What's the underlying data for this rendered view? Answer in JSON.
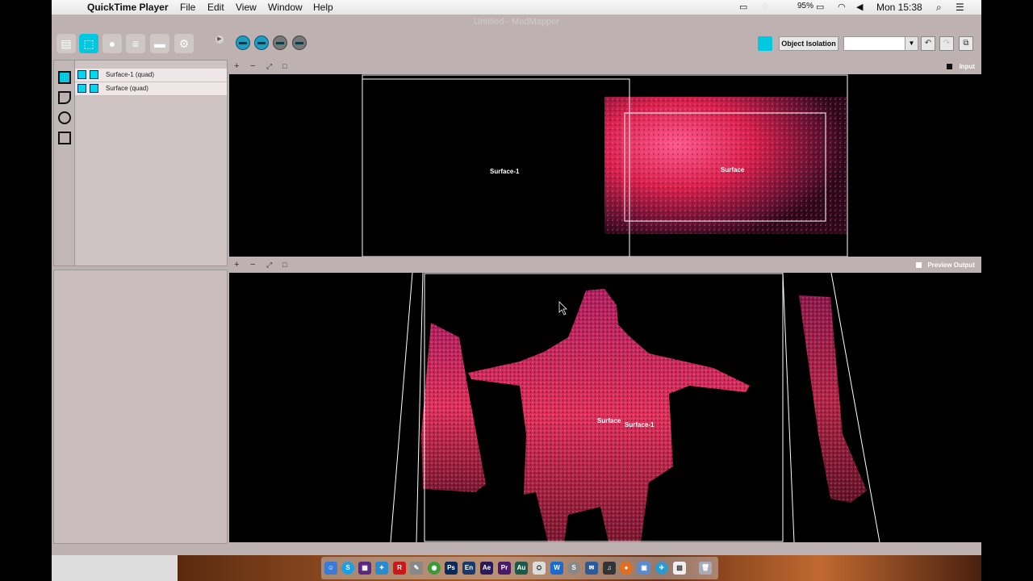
{
  "menubar": {
    "app_name": "QuickTime Player",
    "menus": [
      "File",
      "Edit",
      "View",
      "Window",
      "Help"
    ],
    "battery": "95%",
    "clock": "Mon 15:38"
  },
  "window": {
    "title": "Untitled - MadMapper"
  },
  "toolbar": {
    "object_isolation_label": "Object Isolation"
  },
  "layers": [
    {
      "label": "Surface-1 (quad)"
    },
    {
      "label": "Surface (quad)"
    }
  ],
  "input_panel": {
    "label": "Input",
    "controls": [
      "+",
      "−",
      "⤢",
      "□"
    ],
    "surface_1_label": "Surface-1",
    "surface_label": "Surface"
  },
  "output_panel": {
    "label": "Preview Output",
    "controls": [
      "+",
      "−",
      "⤢",
      "□"
    ],
    "surface_label": "Surface",
    "surface_1_label": "Surface-1"
  },
  "dock": {
    "icons": [
      "Ps",
      "En",
      "Ae",
      "Pr",
      "Au",
      "W",
      "S"
    ]
  },
  "colors": {
    "accent": "#00c8e0",
    "panel_bg": "#bdb1b1",
    "projection": "#e02050"
  }
}
